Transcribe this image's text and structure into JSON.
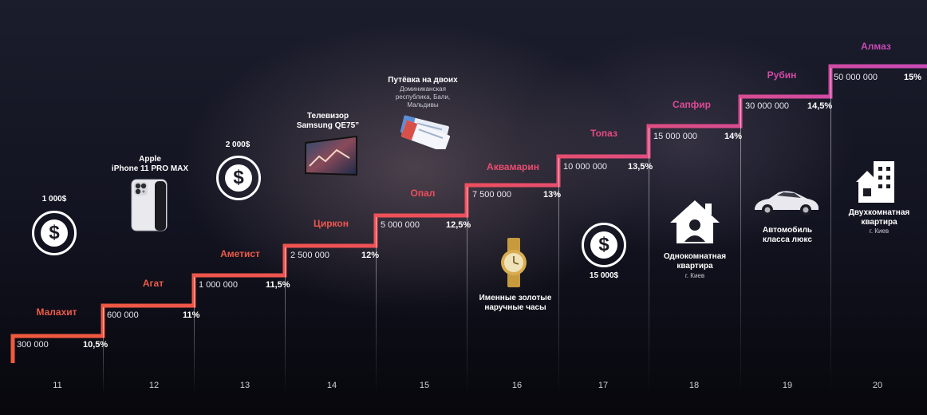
{
  "levels": [
    {
      "num": "11",
      "name": "Малахит",
      "amount": "300 000",
      "pct": "10,5%",
      "color": "#ee5a48"
    },
    {
      "num": "12",
      "name": "Агат",
      "amount": "600 000",
      "pct": "11%",
      "color": "#ee5a48"
    },
    {
      "num": "13",
      "name": "Аметист",
      "amount": "1 000 000",
      "pct": "11,5%",
      "color": "#ee5a48"
    },
    {
      "num": "14",
      "name": "Циркон",
      "amount": "2 500 000",
      "pct": "12%",
      "color": "#ef5550"
    },
    {
      "num": "15",
      "name": "Опал",
      "amount": "5 000 000",
      "pct": "12,5%",
      "color": "#ee4f5c"
    },
    {
      "num": "16",
      "name": "Аквамарин",
      "amount": "7 500 000",
      "pct": "13%",
      "color": "#e94c70"
    },
    {
      "num": "17",
      "name": "Топаз",
      "amount": "10 000 000",
      "pct": "13,5%",
      "color": "#e44a82"
    },
    {
      "num": "18",
      "name": "Сапфир",
      "amount": "15 000 000",
      "pct": "14%",
      "color": "#dc4a96"
    },
    {
      "num": "19",
      "name": "Рубин",
      "amount": "30 000 000",
      "pct": "14,5%",
      "color": "#d24aa6"
    },
    {
      "num": "20",
      "name": "Алмаз",
      "amount": "50 000 000",
      "pct": "15%",
      "color": "#c84ab6"
    }
  ],
  "prizes": {
    "p11": {
      "title": "1 000$",
      "icon": "dollar-icon"
    },
    "p12": {
      "title": "Apple",
      "title2": "iPhone 11 PRO MAX",
      "icon": "smartphone-icon"
    },
    "p13": {
      "title": "2 000$",
      "icon": "dollar-icon"
    },
    "p14": {
      "title": "Телевизор",
      "title2": "Samsung QE75”",
      "icon": "tv-icon"
    },
    "p15": {
      "title": "Путёвка на двоих",
      "sub1": "Доминиканская",
      "sub2": "республика, Бали,",
      "sub3": "Мальдивы",
      "icon": "tickets-icon"
    },
    "p16": {
      "title": "Именные золотые",
      "title2": "наручные часы",
      "icon": "watch-icon"
    },
    "p17": {
      "title": "15 000$",
      "icon": "dollar-icon"
    },
    "p18": {
      "title": "Однокомнатная",
      "title2": "квартира",
      "sub1": "г. Киев",
      "icon": "house-icon"
    },
    "p19": {
      "title": "Автомобиль",
      "title2": "класса люкс",
      "icon": "car-icon"
    },
    "p20": {
      "title": "Двухкомнатная",
      "title2": "квартира",
      "sub1": "г. Киев",
      "icon": "building-icon"
    }
  }
}
